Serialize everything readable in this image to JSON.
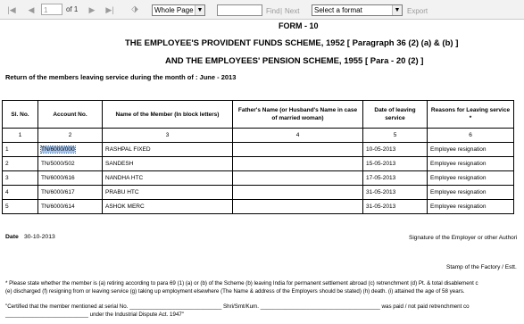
{
  "toolbar": {
    "page_value": "1",
    "page_total": "of 1",
    "zoom_value": "Whole Page",
    "find_label": "Find",
    "separator": "|",
    "next_label": "Next",
    "format_value": "Select a format",
    "export_label": "Export"
  },
  "report": {
    "form_title": "FORM - 10",
    "scheme_line1": "THE EMPLOYEE'S PROVIDENT FUNDS SCHEME, 1952 [ Paragraph 36 (2) (a) & (b) ]",
    "scheme_line2": "AND THE EMPLOYEES' PENSION SCHEME, 1955 [ Para - 20 (2) ]",
    "return_line": "Return of the members leaving service during the month of : June - 2013",
    "columns": [
      "Sl. No.",
      "Account No.",
      "Name of the Member (In block letters)",
      "Father's Name (or Husband's Name in case of married woman)",
      "Date of leaving service",
      "Reasons for Leaving service *"
    ],
    "column_numbers": [
      "1",
      "2",
      "3",
      "4",
      "5",
      "6"
    ],
    "rows": [
      {
        "sl": "1",
        "account": "TN/6000/000",
        "name": "RASHPAL FIXED",
        "father": "",
        "date": "10-05-2013",
        "reason": "Employee resignation"
      },
      {
        "sl": "2",
        "account": "TN/5000/502",
        "name": "SANDESH",
        "father": "",
        "date": "15-05-2013",
        "reason": "Employee resignation"
      },
      {
        "sl": "3",
        "account": "TN/6000/616",
        "name": "NANDHA HTC",
        "father": "",
        "date": "17-05-2013",
        "reason": "Employee resignation"
      },
      {
        "sl": "4",
        "account": "TN/6000/617",
        "name": "PRABU HTC",
        "father": "",
        "date": "31-05-2013",
        "reason": "Employee resignation"
      },
      {
        "sl": "5",
        "account": "TN/6000/614",
        "name": "ASHOK MERC",
        "father": "",
        "date": "31-05-2013",
        "reason": "Employee resignation"
      }
    ],
    "date_label": "Date",
    "date_value": "30-10-2013",
    "signature_text": "Signature of the Employer or other Authori",
    "stamp_text": "Stamp of the Factory / Estt.",
    "note_line1": "* Please state whether the member is (a) retiring according to para 69 (1) (a) or (b) of the Scheme (b) leaving India for permanent settlement abroad (c) retrenchment (d) Pt. & total disablement c",
    "note_line2": "(e) discharged (f) resigning from or leaving service (g) taking up employment elsewhere (The Name & address of the Employers should be stated) (h) death. (i) attained the age of 58 years.",
    "cert_line1": "\"Certified that the member mentioned at serial No. ______________________________ Shri/Smt/Kum. _______________________________________ was paid / not paid retrenchment co",
    "cert_line2": "___________________________ under the Industrial Dispute Act. 1947\""
  },
  "colors": {
    "toolbar_bg": "#f2f2f2",
    "highlight": "#a8c6ee"
  },
  "icons": [
    "first-page-icon",
    "prev-page-icon",
    "next-page-icon",
    "last-page-icon",
    "back-to-parent-icon",
    "cell-action-icon"
  ]
}
